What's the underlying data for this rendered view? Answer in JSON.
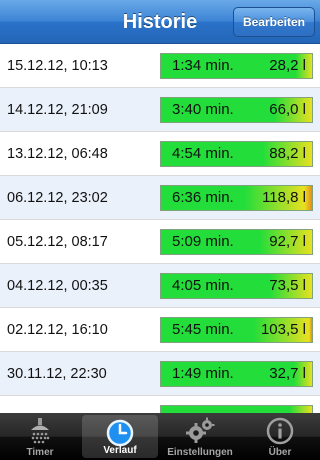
{
  "navbar": {
    "title": "Historie",
    "edit_label": "Bearbeiten"
  },
  "history": [
    {
      "date": "15.12.12, 10:13",
      "duration": "1:34 min.",
      "volume": "28,2 l",
      "liters": 28.2
    },
    {
      "date": "14.12.12, 21:09",
      "duration": "3:40 min.",
      "volume": "66,0 l",
      "liters": 66.0
    },
    {
      "date": "13.12.12, 06:48",
      "duration": "4:54 min.",
      "volume": "88,2 l",
      "liters": 88.2
    },
    {
      "date": "06.12.12, 23:02",
      "duration": "6:36 min.",
      "volume": "118,8 l",
      "liters": 118.8
    },
    {
      "date": "05.12.12, 08:17",
      "duration": "5:09 min.",
      "volume": "92,7 l",
      "liters": 92.7
    },
    {
      "date": "04.12.12, 00:35",
      "duration": "4:05 min.",
      "volume": "73,5 l",
      "liters": 73.5
    },
    {
      "date": "02.12.12, 16:10",
      "duration": "5:45 min.",
      "volume": "103,5 l",
      "liters": 103.5
    },
    {
      "date": "30.11.12, 22:30",
      "duration": "1:49 min.",
      "volume": "32,7 l",
      "liters": 32.7
    },
    {
      "date": "",
      "duration": "",
      "volume": "",
      "liters": 40.0
    }
  ],
  "tabbar": {
    "tabs": [
      {
        "label": "Timer",
        "icon": "shower-icon"
      },
      {
        "label": "Verlauf",
        "icon": "clock-icon"
      },
      {
        "label": "Einstellungen",
        "icon": "gears-icon"
      },
      {
        "label": "Über",
        "icon": "info-icon"
      }
    ],
    "active": "Verlauf"
  },
  "colors": {
    "navbar": "#2f78cc",
    "row_alt": "#eaf1fb",
    "meter_green": "#22dd3a",
    "meter_yellow": "#e8e020",
    "meter_orange": "#e88a1c"
  }
}
